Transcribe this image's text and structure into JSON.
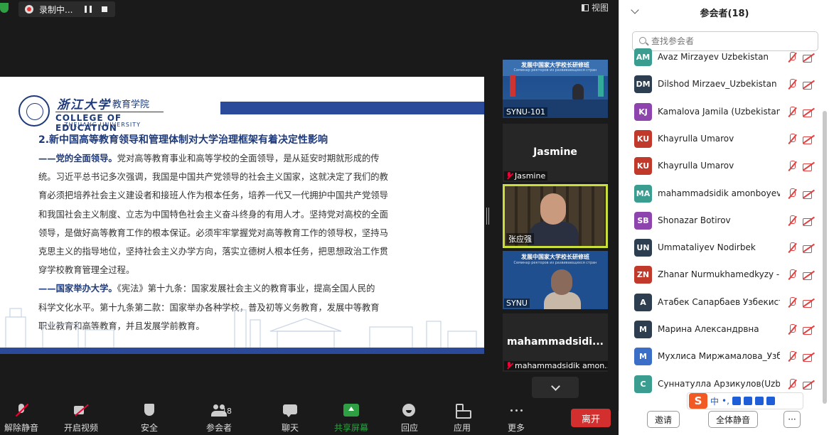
{
  "recording": {
    "label": "录制中..."
  },
  "view_button": {
    "label": "视图"
  },
  "slide": {
    "brand_cn": "浙江大学",
    "brand_sub": "教育学院",
    "brand_en": "COLLEGE OF EDUCATION",
    "brand_en2": "ZHEJIANG UNIVERSITY",
    "heading": "2.新中国高等教育领导和管理体制对大学治理框架有着决定性影响",
    "lines": [
      {
        "hl": "——党的全面领导。",
        "text": "党对高等教育事业和高等学校的全面领导，是从延安时期就形成的传"
      },
      {
        "hl": "",
        "text": "统。习近平总书记多次强调，我国是中国共产党领导的社会主义国家，这就决定了我们的教"
      },
      {
        "hl": "",
        "text": "育必须把培养社会主义建设者和接班人作为根本任务，培养一代又一代拥护中国共产党领导"
      },
      {
        "hl": "",
        "text": "和我国社会主义制度、立志为中国特色社会主义奋斗终身的有用人才。坚持党对高校的全面"
      },
      {
        "hl": "",
        "text": "领导，是做好高等教育工作的根本保证。必须牢牢掌握党对高等教育工作的领导权，坚持马"
      },
      {
        "hl": "",
        "text": "克思主义的指导地位，坚持社会主义办学方向，落实立德树人根本任务，把思想政治工作贯"
      },
      {
        "hl": "",
        "text": "穿学校教育管理全过程。"
      },
      {
        "hl": "——国家举办大学。",
        "text": "《宪法》第十九条：国家发展社会主义的教育事业，提高全国人民的"
      },
      {
        "hl": "",
        "text": "科学文化水平。第十九条第二款：国家举办各种学校，普及初等义务教育，发展中等教育"
      },
      {
        "hl": "",
        "text": "职业教育和高等教育，并且发展学前教育。"
      }
    ]
  },
  "thumbnails": {
    "t1": {
      "name": "SYNU-101",
      "banner": "发展中国家大学校长研修班",
      "banner2": "Семинар ректоров из развивающихся стран"
    },
    "t2": {
      "big_name": "Jasmine",
      "name": "Jasmine"
    },
    "t3": {
      "name": "张应强"
    },
    "t4": {
      "name": "SYNU",
      "banner": "发展中国家大学校长研修班",
      "banner2": "Семинар ректоров из развивающихся стран"
    },
    "t5": {
      "big_name": "mahammadsidi...",
      "name": "mahammadsidik amon..."
    }
  },
  "toolbar": {
    "unmute": "解除静音",
    "start_video": "开启视频",
    "security": "安全",
    "participants": "参会者",
    "participants_count": "18",
    "chat": "聊天",
    "share_screen": "共享屏幕",
    "reactions": "回应",
    "apps": "应用",
    "more": "更多",
    "leave": "离开"
  },
  "panel": {
    "title": "参会者(18)",
    "search_placeholder": "查找参会者",
    "participants": [
      {
        "initials": "AM",
        "name": "Avaz Mirzayev Uzbekistan",
        "color": "#3a9d8f"
      },
      {
        "initials": "DM",
        "name": "Dilshod Mirzaev_Uzbekistan",
        "color": "#2d3e50"
      },
      {
        "initials": "KJ",
        "name": "Kamalova Jamila (Uzbekistan)",
        "color": "#8e44ad"
      },
      {
        "initials": "KU",
        "name": "Khayrulla Umarov",
        "color": "#c0392b"
      },
      {
        "initials": "KU",
        "name": "Khayrulla Umarov",
        "color": "#c0392b"
      },
      {
        "initials": "MA",
        "name": "mahammadsidik amonboyev",
        "color": "#3a9d8f"
      },
      {
        "initials": "SB",
        "name": "Shonazar Botirov",
        "color": "#8e44ad"
      },
      {
        "initials": "UN",
        "name": "Ummataliyev Nodirbek",
        "color": "#2d3e50"
      },
      {
        "initials": "ZN",
        "name": "Zhanar Nurmukhamedkyzy - Zh...",
        "color": "#c0392b"
      },
      {
        "initials": "A",
        "name": "Атабек Сапарбаев Узбекистан",
        "color": "#2d3e50"
      },
      {
        "initials": "M",
        "name": "Марина Александрвна",
        "color": "#2d3e50"
      },
      {
        "initials": "M",
        "name": "Мухлиса Миржамалова_Узбе...",
        "color": "#3b6fc7"
      },
      {
        "initials": "C",
        "name": "Суннатулла Арзикулов(Uzbek...",
        "color": "#3a9d8f"
      }
    ],
    "invite": "邀请",
    "mute_all": "全体静音",
    "more": "···"
  },
  "ime": {
    "logo": "S",
    "mode": "中",
    "punct": "•,"
  }
}
